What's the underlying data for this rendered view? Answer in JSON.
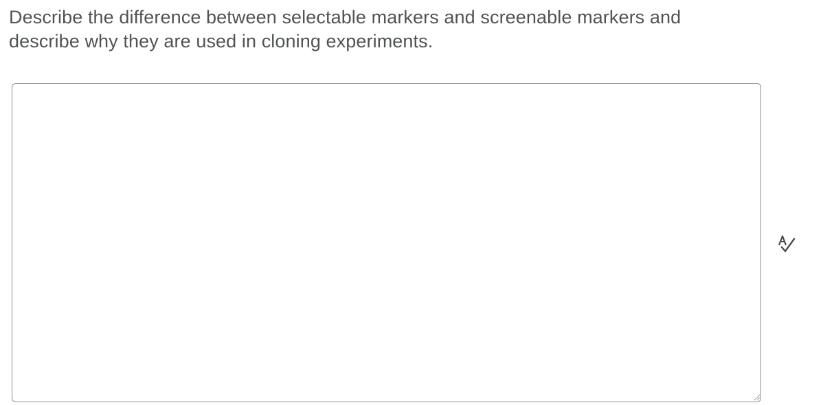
{
  "question": {
    "text": "Describe the difference between selectable markers and screenable markers and describe why they are used in cloning experiments."
  },
  "answer": {
    "value": "",
    "placeholder": ""
  },
  "icons": {
    "spellcheck": "spellcheck-icon",
    "resize": "resize-handle-icon"
  },
  "colors": {
    "text": "#505356",
    "border": "#8a8d90",
    "icon": "#494c4e"
  }
}
